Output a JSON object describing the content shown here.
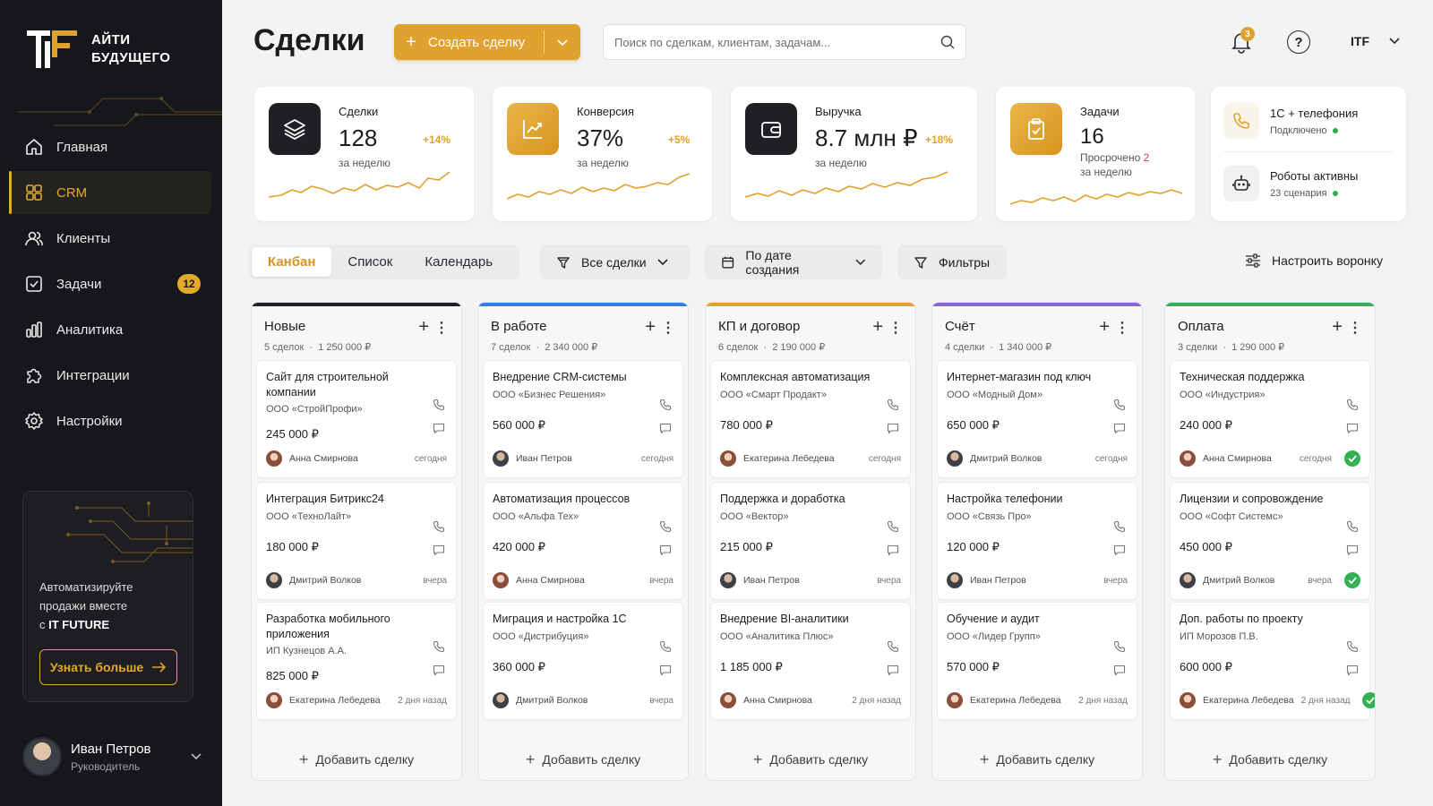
{
  "brand": {
    "line1": "АЙТИ",
    "line2": "БУДУЩЕГО",
    "accent": "#e1a12e"
  },
  "nav": [
    {
      "label": "Главная",
      "icon": "home-icon"
    },
    {
      "label": "CRM",
      "icon": "crm-grid-icon",
      "active": true
    },
    {
      "label": "Клиенты",
      "icon": "users-icon"
    },
    {
      "label": "Задачи",
      "icon": "task-check-icon",
      "badge": "12"
    },
    {
      "label": "Аналитика",
      "icon": "analytics-bars-icon"
    },
    {
      "label": "Интеграции",
      "icon": "puzzle-icon"
    },
    {
      "label": "Настройки",
      "icon": "gear-icon"
    }
  ],
  "promo": {
    "line1": "Автоматизируйте",
    "line2": "продажи вместе",
    "line3_prefix": "с ",
    "line3_brand": "IT FUTURE",
    "button": "Узнать больше"
  },
  "user": {
    "name": "Иван Петров",
    "role": "Руководитель"
  },
  "header": {
    "title": "Сделки",
    "create": "Создать сделку",
    "search_placeholder": "Поиск по сделкам, клиентам, задачам...",
    "notifications": "3",
    "account": "ITF"
  },
  "kpis": [
    {
      "label": "Сделки",
      "value": "128",
      "sub": "за неделю",
      "delta": "+14%",
      "icon": "layers-icon"
    },
    {
      "label": "Конверсия",
      "value": "37%",
      "sub": "за неделю",
      "delta": "+5%",
      "icon": "trend-up-icon"
    },
    {
      "label": "Выручка",
      "value": "8.7 млн ₽",
      "sub": "за неделю",
      "delta": "+18%",
      "icon": "wallet-icon"
    },
    {
      "label": "Задачи",
      "value": "16",
      "sub_prefix": "Просрочено",
      "sub_count": "2",
      "sub": "за неделю",
      "icon": "clipboard-icon"
    }
  ],
  "status": [
    {
      "title": "1С + телефония",
      "sub": "Подключено",
      "icon": "phone-icon"
    },
    {
      "title": "Роботы активны",
      "sub": "23 сценария",
      "icon": "robot-icon"
    }
  ],
  "views": [
    "Канбан",
    "Список",
    "Календарь"
  ],
  "toolbar": {
    "deals": "Все сделки",
    "sort": "По дате создания",
    "filters": "Фильтры",
    "tune": "Настроить воронку"
  },
  "add_deal": "Добавить сделку",
  "columns": [
    {
      "title": "Новые",
      "count": "5 сделок",
      "sum": "1 250 000 ₽",
      "color": "#1f2024",
      "cards": [
        {
          "title": "Сайт для строительной компании",
          "company": "ООО «СтройПрофи»",
          "amount": "245 000 ₽",
          "owner": "Анна Смирнова",
          "when": "сегодня",
          "gender": "f"
        },
        {
          "title": "Интеграция Битрикс24",
          "company": "ООО «ТехноЛайт»",
          "amount": "180 000 ₽",
          "owner": "Дмитрий Волков",
          "when": "вчера",
          "gender": "m"
        },
        {
          "title": "Разработка мобильного приложения",
          "company": "ИП Кузнецов А.А.",
          "amount": "825 000 ₽",
          "owner": "Екатерина Лебедева",
          "when": "2 дня назад",
          "gender": "f"
        }
      ]
    },
    {
      "title": "В работе",
      "count": "7 сделок",
      "sum": "2 340 000 ₽",
      "color": "#2f7fe0",
      "cards": [
        {
          "title": "Внедрение CRM-системы",
          "company": "ООО «Бизнес Решения»",
          "amount": "560 000 ₽",
          "owner": "Иван Петров",
          "when": "сегодня",
          "gender": "m"
        },
        {
          "title": "Автоматизация процессов",
          "company": "ООО «Альфа Тех»",
          "amount": "420 000 ₽",
          "owner": "Анна Смирнова",
          "when": "вчера",
          "gender": "f"
        },
        {
          "title": "Миграция и настройка 1С",
          "company": "ООО «Дистрибуция»",
          "amount": "360 000 ₽",
          "owner": "Дмитрий Волков",
          "when": "вчера",
          "gender": "m"
        }
      ]
    },
    {
      "title": "КП и договор",
      "count": "6 сделок",
      "sum": "2 190 000 ₽",
      "color": "#e1a12e",
      "cards": [
        {
          "title": "Комплексная автоматизация",
          "company": "ООО «Смарт Продакт»",
          "amount": "780 000 ₽",
          "owner": "Екатерина Лебедева",
          "when": "сегодня",
          "gender": "f"
        },
        {
          "title": "Поддержка и доработка",
          "company": "ООО «Вектор»",
          "amount": "215 000 ₽",
          "owner": "Иван Петров",
          "when": "вчера",
          "gender": "m"
        },
        {
          "title": "Внедрение BI-аналитики",
          "company": "ООО «Аналитика Плюс»",
          "amount": "1 185 000 ₽",
          "owner": "Анна Смирнова",
          "when": "2 дня назад",
          "gender": "f"
        }
      ]
    },
    {
      "title": "Счёт",
      "count": "4 сделки",
      "sum": "1 340 000 ₽",
      "color": "#8a63d2",
      "cards": [
        {
          "title": "Интернет-магазин под ключ",
          "company": "ООО «Модный Дом»",
          "amount": "650 000 ₽",
          "owner": "Дмитрий Волков",
          "when": "сегодня",
          "gender": "m"
        },
        {
          "title": "Настройка телефонии",
          "company": "ООО «Связь Про»",
          "amount": "120 000 ₽",
          "owner": "Иван Петров",
          "when": "вчера",
          "gender": "m"
        },
        {
          "title": "Обучение и аудит",
          "company": "ООО «Лидер Групп»",
          "amount": "570 000 ₽",
          "owner": "Екатерина Лебедева",
          "when": "2 дня назад",
          "gender": "f"
        }
      ]
    },
    {
      "title": "Оплата",
      "count": "3 сделки",
      "sum": "1 290 000 ₽",
      "color": "#3aac5a",
      "cards": [
        {
          "title": "Техническая поддержка",
          "company": "ООО «Индустрия»",
          "amount": "240 000 ₽",
          "owner": "Анна Смирнова",
          "when": "сегодня",
          "gender": "f",
          "paid": true
        },
        {
          "title": "Лицензии и сопровождение",
          "company": "ООО «Софт Системс»",
          "amount": "450 000 ₽",
          "owner": "Дмитрий Волков",
          "when": "вчера",
          "gender": "m",
          "paid": true
        },
        {
          "title": "Доп. работы по проекту",
          "company": "ИП Морозов П.В.",
          "amount": "600 000 ₽",
          "owner": "Екатерина Лебедева",
          "when": "2 дня назад",
          "gender": "f",
          "paid": true
        }
      ]
    }
  ]
}
